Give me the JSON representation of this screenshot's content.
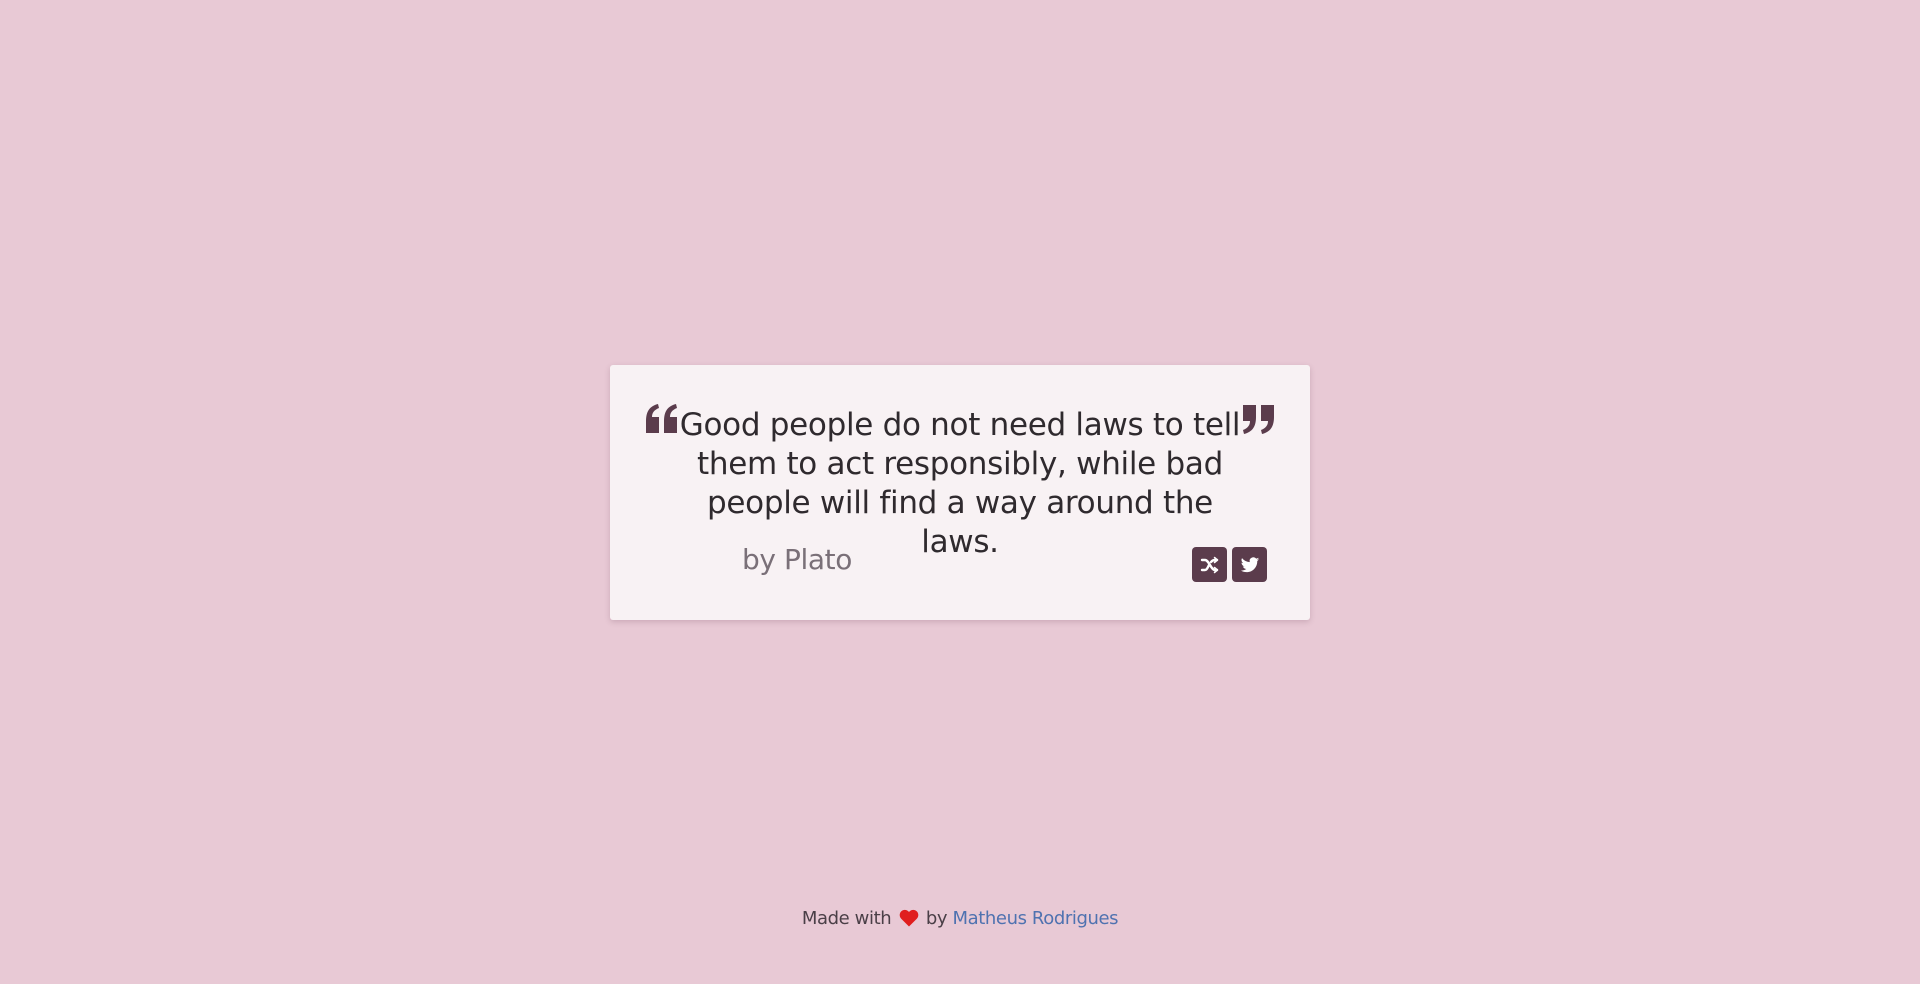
{
  "quote": {
    "text": "Good people do not need laws to tell them to act responsibly, while bad people will find a way around the laws.",
    "author": "by Plato"
  },
  "icons": {
    "open_quote": "quote-left-icon",
    "close_quote": "quote-right-icon",
    "shuffle": "random-icon",
    "tweet": "twitter-icon",
    "heart": "heart-icon"
  },
  "footer": {
    "made_with": "Made with",
    "by": "by",
    "author_link": "Matheus Rodrigues"
  },
  "colors": {
    "background": "#e8c9d5",
    "card": "#f8f2f4",
    "accent": "#5b3c4c",
    "heart": "#e01e1e",
    "link": "#4f72b0"
  }
}
